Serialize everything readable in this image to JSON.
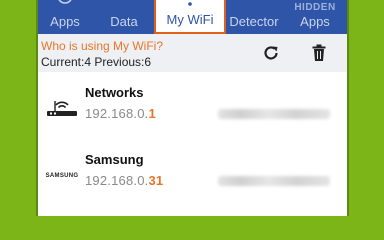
{
  "tabs": [
    {
      "label": "Apps"
    },
    {
      "label": "Data"
    },
    {
      "label": "My WiFi"
    },
    {
      "label": "Detector"
    },
    {
      "label": "Apps",
      "top": "HIDDEN"
    }
  ],
  "header": {
    "title": "Who is using My WiFi?",
    "counts": "Current:4 Previous:6"
  },
  "devices": [
    {
      "name": "Networks",
      "ip_prefix": "192.168.0.",
      "ip_last": "1",
      "icon": "router-icon"
    },
    {
      "name": "Samsung",
      "ip_prefix": "192.168.0.",
      "ip_last": "31",
      "icon": "samsung-logo",
      "logo_text": "SAMSUNG"
    }
  ],
  "colors": {
    "tabbar": "#2f55a8",
    "accent": "#e8762a",
    "background": "#7cb518"
  }
}
